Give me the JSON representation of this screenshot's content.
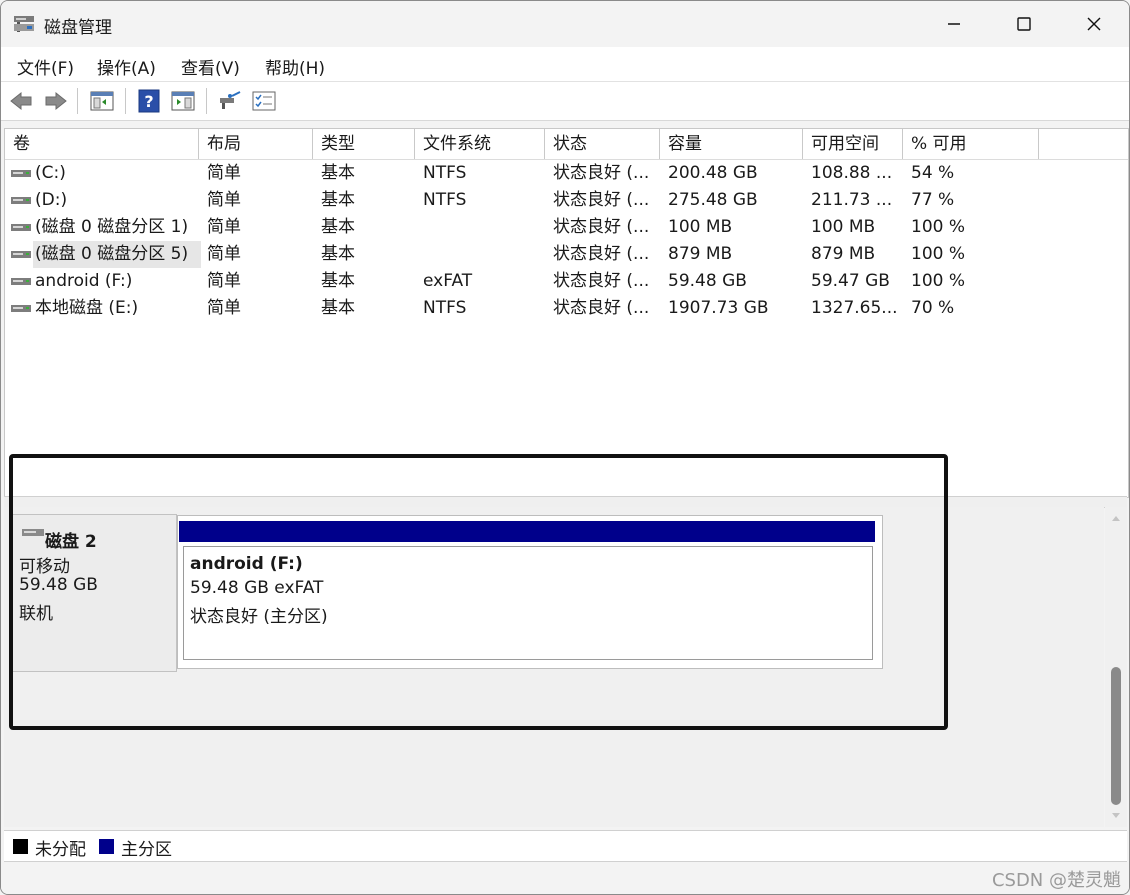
{
  "window": {
    "title": "磁盘管理"
  },
  "menu": [
    "文件(F)",
    "操作(A)",
    "查看(V)",
    "帮助(H)"
  ],
  "toolbar": {
    "buttons": [
      "back-icon",
      "forward-icon",
      "properties-icon",
      "help-icon",
      "console-tree-icon",
      "connect-icon",
      "checklist-icon"
    ]
  },
  "table": {
    "columns": [
      "卷",
      "布局",
      "类型",
      "文件系统",
      "状态",
      "容量",
      "可用空间",
      "% 可用"
    ],
    "rows": [
      [
        "(C:)",
        "简单",
        "基本",
        "NTFS",
        "状态良好 (...",
        "200.48 GB",
        "108.88 ...",
        "54 %"
      ],
      [
        "(D:)",
        "简单",
        "基本",
        "NTFS",
        "状态良好 (...",
        "275.48 GB",
        "211.73 ...",
        "77 %"
      ],
      [
        "(磁盘 0 磁盘分区 1)",
        "简单",
        "基本",
        "",
        "状态良好 (...",
        "100 MB",
        "100 MB",
        "100 %"
      ],
      [
        "(磁盘 0 磁盘分区 5)",
        "简单",
        "基本",
        "",
        "状态良好 (...",
        "879 MB",
        "879 MB",
        "100 %"
      ],
      [
        "android (F:)",
        "简单",
        "基本",
        "exFAT",
        "状态良好 (...",
        "59.48 GB",
        "59.47 GB",
        "100 %"
      ],
      [
        "本地磁盘 (E:)",
        "简单",
        "基本",
        "NTFS",
        "状态良好 (...",
        "1907.73 GB",
        "1327.65...",
        "70 %"
      ]
    ]
  },
  "disk": {
    "name": "磁盘 2",
    "type": "可移动",
    "size": "59.48 GB",
    "state": "联机",
    "partition": {
      "name": "android  (F:)",
      "size_fs": "59.48 GB exFAT",
      "status": "状态良好 (主分区)"
    }
  },
  "legend": [
    {
      "label": "未分配",
      "color": "#000000"
    },
    {
      "label": "主分区",
      "color": "#00008b"
    }
  ],
  "watermark": "CSDN @楚灵魈",
  "colors": {
    "primary_partition": "#00008b",
    "highlight_box": "#111111"
  }
}
